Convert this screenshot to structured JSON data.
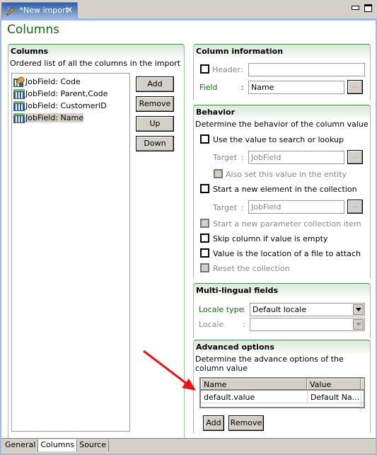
{
  "editor_tab": {
    "title": "*New import",
    "icon": "edit-icon",
    "close_icon": "close-icon"
  },
  "window_controls": {
    "minimize_icon": "minimize-icon",
    "maximize_icon": "maximize-icon"
  },
  "page": {
    "title": "Columns"
  },
  "columns_section": {
    "title": "Columns",
    "description": "Ordered list of all the columns in the import",
    "items": [
      {
        "label": "JobField: Code",
        "icon": "key-column-icon",
        "selected": false
      },
      {
        "label": "JobField: Parent,Code",
        "icon": "column-icon",
        "selected": false
      },
      {
        "label": "JobField: CustomerID",
        "icon": "column-icon",
        "selected": false
      },
      {
        "label": "JobField: Name",
        "icon": "column-icon",
        "selected": true
      }
    ],
    "buttons": {
      "add": "Add",
      "remove": "Remove",
      "up": "Up",
      "down": "Down"
    }
  },
  "column_information": {
    "title": "Column information",
    "header_label": "Header",
    "header_checked": false,
    "header_value": "",
    "field_label": "Field",
    "field_value": "Name",
    "colon": ":",
    "browse_label": "..."
  },
  "behavior": {
    "title": "Behavior",
    "description": "Determine the behavior of the column value",
    "use_search": {
      "label": "Use the value to search or lookup",
      "checked": false
    },
    "target_label": "Target",
    "target1_value": "JobField",
    "also_set": {
      "label": "Also set this value in the entity",
      "checked": false,
      "disabled": true
    },
    "new_element": {
      "label": "Start a new element in the collection",
      "checked": false
    },
    "target2_value": "JobField",
    "new_param": {
      "label": "Start a new parameter collection item",
      "checked": false,
      "disabled": true
    },
    "skip_empty": {
      "label": "Skip column if value is empty",
      "checked": false
    },
    "file_attach": {
      "label": "Value is the location of a file to attach",
      "checked": false
    },
    "reset": {
      "label": "Reset the collection",
      "checked": false,
      "disabled": true
    }
  },
  "multilingual": {
    "title": "Multi-lingual fields",
    "locale_type_label": "Locale type",
    "locale_type_value": "Default locale",
    "locale_label": "Locale",
    "locale_value": ""
  },
  "advanced": {
    "title": "Advanced options",
    "description": "Determine the advance options of the column value",
    "table": {
      "columns": [
        "Name",
        "Value"
      ],
      "rows": [
        {
          "name": "default.value",
          "value": "Default Na..."
        }
      ]
    },
    "buttons": {
      "add": "Add",
      "remove": "Remove"
    }
  },
  "bottom_tabs": [
    {
      "label": "General",
      "active": false
    },
    {
      "label": "Columns",
      "active": true
    },
    {
      "label": "Source",
      "active": false
    }
  ],
  "annotation": {
    "arrow_color": "#ee1111"
  },
  "colors": {
    "accent_green": "#0f6b0f",
    "frame_blue": "#9fbbe3"
  }
}
